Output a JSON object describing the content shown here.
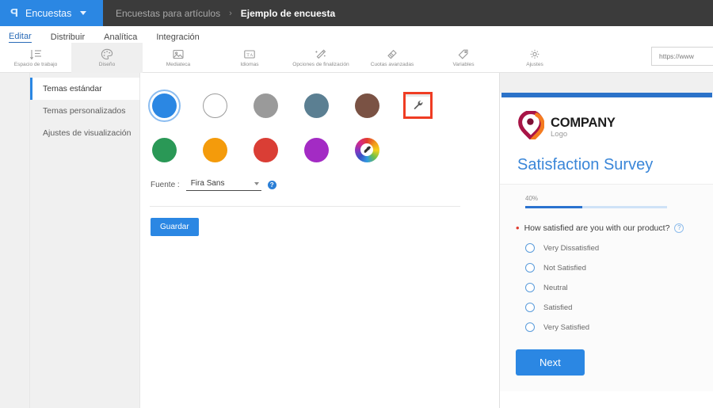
{
  "header": {
    "brand_glyph": "P",
    "brand_label": "Encuestas",
    "breadcrumb_parent": "Encuestas para artículos",
    "breadcrumb_sep": "›",
    "breadcrumb_current": "Ejemplo de encuesta"
  },
  "tabs": [
    {
      "label": "Editar",
      "active": true
    },
    {
      "label": "Distribuir",
      "active": false
    },
    {
      "label": "Analítica",
      "active": false
    },
    {
      "label": "Integración",
      "active": false
    }
  ],
  "toolbar": {
    "items": [
      {
        "label": "Espacio de trabajo",
        "icon": "workspace-icon",
        "active": false
      },
      {
        "label": "Diseño",
        "icon": "palette-icon",
        "active": true
      },
      {
        "label": "Mediateca",
        "icon": "media-library-icon",
        "active": false
      },
      {
        "label": "Idiomas",
        "icon": "languages-icon",
        "active": false
      },
      {
        "label": "Opciones de finalización",
        "icon": "magic-wand-icon",
        "active": false
      },
      {
        "label": "Cuotas avanzadas",
        "icon": "quotas-icon",
        "active": false
      },
      {
        "label": "Variables",
        "icon": "tag-icon",
        "active": false
      },
      {
        "label": "Ajustes",
        "icon": "gear-icon",
        "active": false
      }
    ],
    "url_value": "https://www"
  },
  "sidebar": {
    "items": [
      {
        "label": "Temas estándar",
        "active": true
      },
      {
        "label": "Temas personalizados",
        "active": false
      },
      {
        "label": "Ajustes de visualización",
        "active": false
      }
    ]
  },
  "editor": {
    "theme_colors_row1": [
      {
        "name": "blue",
        "hex": "#2B87E3",
        "selected": true,
        "type": "dot"
      },
      {
        "name": "white",
        "hex": "#FFFFFF",
        "selected": false,
        "type": "dot-outline"
      },
      {
        "name": "gray",
        "hex": "#9A9A9A",
        "selected": false,
        "type": "dot"
      },
      {
        "name": "slate",
        "hex": "#5B7F92",
        "selected": false,
        "type": "dot"
      },
      {
        "name": "brown",
        "hex": "#7A5244",
        "selected": false,
        "type": "dot"
      },
      {
        "name": "custom-theme-tool",
        "hex": "#FFFFFF",
        "selected": false,
        "type": "tool"
      }
    ],
    "theme_colors_row2": [
      {
        "name": "green",
        "hex": "#2A9856",
        "selected": false,
        "type": "dot"
      },
      {
        "name": "orange",
        "hex": "#F49B0B",
        "selected": false,
        "type": "dot"
      },
      {
        "name": "red",
        "hex": "#DA3E35",
        "selected": false,
        "type": "dot"
      },
      {
        "name": "purple",
        "hex": "#A32BC4",
        "selected": false,
        "type": "dot"
      },
      {
        "name": "color-picker",
        "hex": "#FFFFFF",
        "selected": false,
        "type": "wheel"
      }
    ],
    "font_label": "Fuente :",
    "font_value": "Fira Sans",
    "font_help": "?",
    "save_label": "Guardar",
    "highlight_color": "#EF3C23"
  },
  "preview": {
    "logo_company": "COMPANY",
    "logo_sub": "Logo",
    "survey_title": "Satisfaction Survey",
    "progress_label": "40%",
    "progress_percent": 40,
    "question_text": "How satisfied are you with our product?",
    "question_help": "?",
    "options": [
      "Very Dissatisfied",
      "Not Satisfied",
      "Neutral",
      "Satisfied",
      "Very Satisfied"
    ],
    "next_label": "Next",
    "accent_color": "#2B87E3",
    "title_color": "#3A86D8"
  }
}
